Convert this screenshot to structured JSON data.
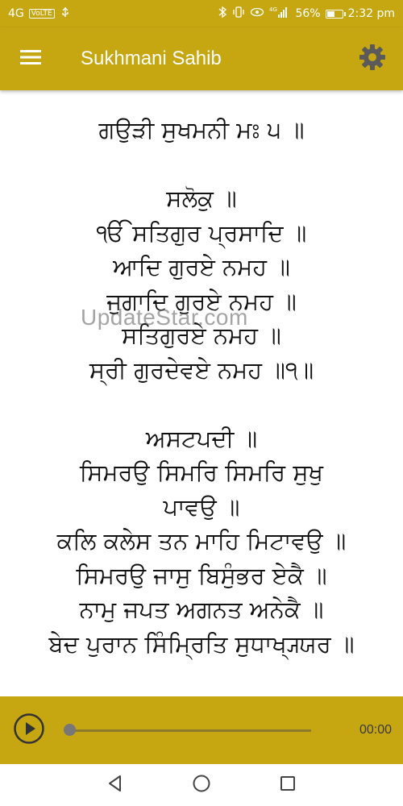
{
  "status_bar": {
    "network": "4G",
    "volte": "VoLTE",
    "network_type": "4G",
    "battery_percent": "56%",
    "battery_level": 0.56,
    "time": "2:32 pm"
  },
  "app_bar": {
    "title": "Sukhmani Sahib",
    "menu_icon": "hamburger-menu-icon",
    "settings_icon": "gear-icon"
  },
  "content": {
    "lines": [
      "ਗਉੜੀ ਸੁਖਮਨੀ ਮਃ ੫ ॥",
      "",
      "ਸਲੋਕੁ ॥",
      "ੴ ਸਤਿਗੁਰ ਪ੍ਰਸਾਦਿ ॥",
      "ਆਦਿ ਗੁਰਏ ਨਮਹ ॥",
      "ਜੁਗਾਦਿ ਗੁਰਏ ਨਮਹ ॥",
      "ਸਤਿਗੁਰਏ ਨਮਹ ॥",
      "ਸ੍ਰੀ ਗੁਰਦੇਵਏ ਨਮਹ ॥੧॥",
      "",
      "ਅਸਟਪਦੀ ॥",
      "ਸਿਮਰਉ ਸਿਮਰਿ ਸਿਮਰਿ ਸੁਖੁ",
      "ਪਾਵਉ ॥",
      "ਕਲਿ ਕਲੇਸ ਤਨ ਮਾਹਿ ਮਿਟਾਵਉ ॥",
      "ਸਿਮਰਉ ਜਾਸੁ ਬਿਸੁੰਭਰ ਏਕੈ ॥",
      "ਨਾਮੁ ਜਪਤ ਅਗਨਤ ਅਨੇਕੈ ॥",
      "ਬੇਦ ਪੁਰਾਨ ਸਿੰਮ੍ਰਿਤਿ ਸੁਧਾਖ੍ਯ੍ਯਰ ॥"
    ],
    "watermark": "UpdateStar.com"
  },
  "player": {
    "play_icon": "play-circle-icon",
    "progress": 0,
    "time": "00:00"
  },
  "nav_bar": {
    "back_icon": "back-triangle-icon",
    "home_icon": "home-circle-icon",
    "recents_icon": "recents-square-icon"
  },
  "colors": {
    "accent": "#c6a711",
    "text": "#111111"
  }
}
